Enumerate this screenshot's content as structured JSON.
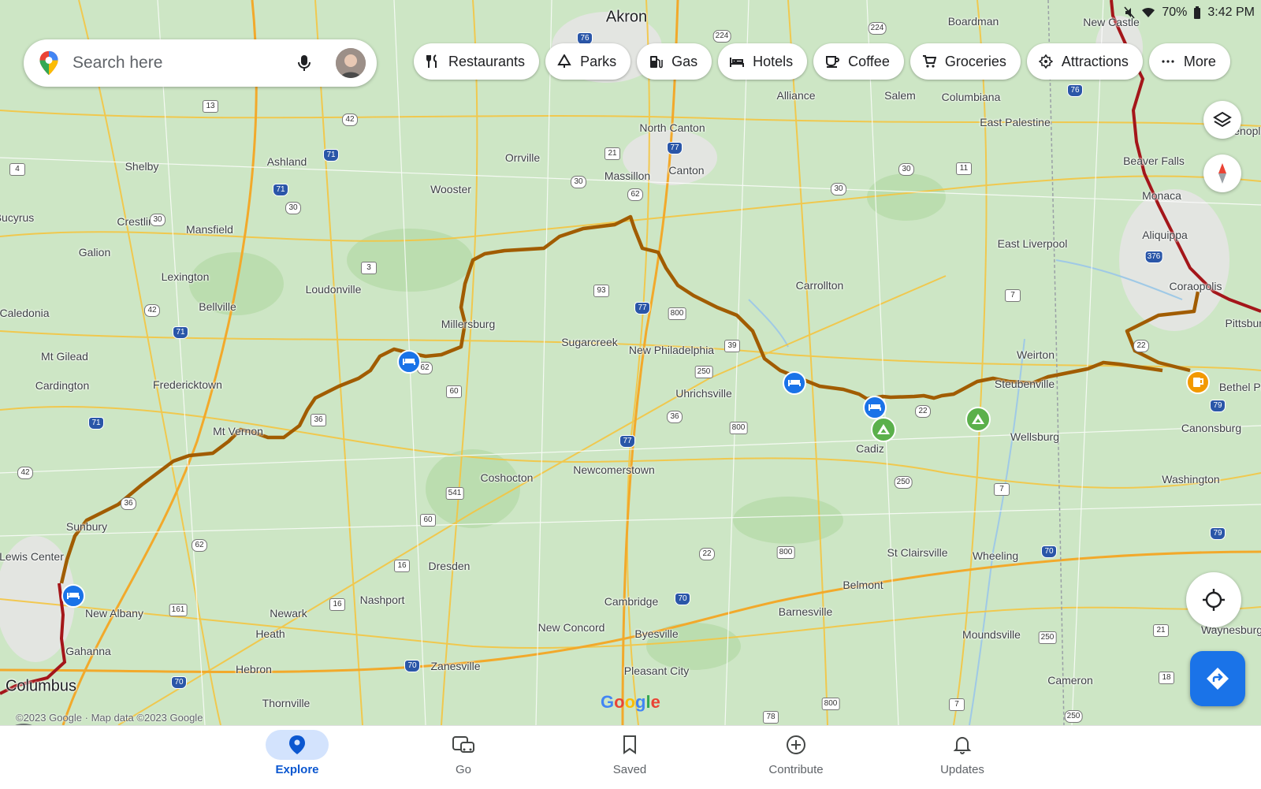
{
  "status_bar": {
    "battery": "70%",
    "time": "3:42 PM"
  },
  "search": {
    "placeholder": "Search here"
  },
  "chips": [
    {
      "label": "Restaurants",
      "icon": "fork-knife-icon"
    },
    {
      "label": "Parks",
      "icon": "tree-icon"
    },
    {
      "label": "Gas",
      "icon": "gas-pump-icon"
    },
    {
      "label": "Hotels",
      "icon": "bed-icon"
    },
    {
      "label": "Coffee",
      "icon": "coffee-cup-icon"
    },
    {
      "label": "Groceries",
      "icon": "cart-icon"
    },
    {
      "label": "Attractions",
      "icon": "attraction-icon"
    },
    {
      "label": "More",
      "icon": "more-dots-icon"
    }
  ],
  "map": {
    "places": [
      "Akron",
      "Boardman",
      "New Castle",
      "Alliance",
      "Salem",
      "Columbiana",
      "East Palestine",
      "North Canton",
      "Orrville",
      "Massillon",
      "Canton",
      "Shelby",
      "Ashland",
      "Wooster",
      "Beaver Falls",
      "Monaca",
      "Aliquippa",
      "East Liverpool",
      "Crestline",
      "Mansfield",
      "Galion",
      "Lexington",
      "Loudonville",
      "Bucyrus",
      "Bellville",
      "Caledonia",
      "Carrollton",
      "Coraopolis",
      "Millersburg",
      "Sugarcreek",
      "New Philadelphia",
      "Mt Gilead",
      "Weirton",
      "Cardington",
      "Fredericktown",
      "Uhrichsville",
      "Steubenville",
      "Mt Vernon",
      "Cadiz",
      "Wellsburg",
      "Canonsburg",
      "Coshocton",
      "Newcomerstown",
      "Washington",
      "Sunbury",
      "Lewis Center",
      "Dresden",
      "St Clairsville",
      "Wheeling",
      "New Albany",
      "Nashport",
      "Belmont",
      "Newark",
      "Cambridge",
      "Barnesville",
      "Heath",
      "Gahanna",
      "New Concord",
      "Byesville",
      "Moundsville",
      "Waynesburg",
      "Hebron",
      "Zanesville",
      "Pleasant City",
      "Cameron",
      "Columbus",
      "Thornville",
      "Zelienople",
      "Pittsburgh",
      "Bethel Park"
    ],
    "route_color": "#a15c00",
    "attribution": "©2023 Google · Map data ©2023 Google",
    "logo": "Google"
  },
  "bottom_nav": [
    {
      "label": "Explore",
      "icon": "explore-pin-icon",
      "active": true
    },
    {
      "label": "Go",
      "icon": "commute-icon",
      "active": false
    },
    {
      "label": "Saved",
      "icon": "bookmark-icon",
      "active": false
    },
    {
      "label": "Contribute",
      "icon": "plus-circle-icon",
      "active": false
    },
    {
      "label": "Updates",
      "icon": "bell-icon",
      "active": false
    }
  ]
}
